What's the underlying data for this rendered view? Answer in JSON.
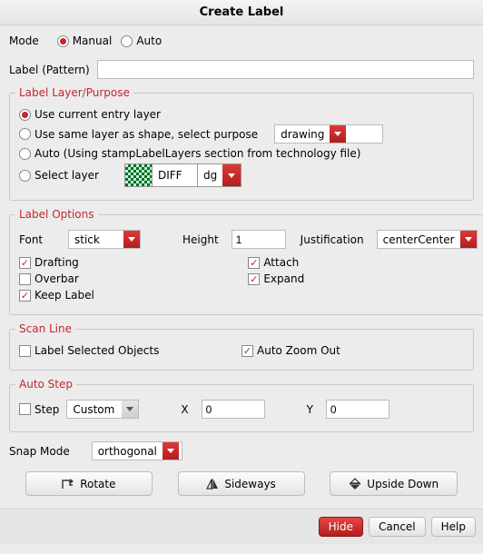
{
  "title": "Create Label",
  "mode": {
    "label": "Mode",
    "options": {
      "manual": "Manual",
      "auto": "Auto"
    },
    "selected": "manual"
  },
  "labelPattern": {
    "label": "Label (Pattern)",
    "value": ""
  },
  "layerPurpose": {
    "legend": "Label Layer/Purpose",
    "useCurrent": {
      "label": "Use current entry layer"
    },
    "sameShape": {
      "label": "Use same layer as shape, select purpose",
      "purpose": "drawing"
    },
    "autoTech": {
      "label": "Auto (Using stampLabelLayers section from technology file)"
    },
    "selectLayer": {
      "label": "Select layer",
      "layerName": "DIFF",
      "layerPurpose": "dg"
    },
    "selected": "useCurrent"
  },
  "labelOptions": {
    "legend": "Label Options",
    "fontLabel": "Font",
    "fontValue": "stick",
    "heightLabel": "Height",
    "heightValue": "1",
    "justificationLabel": "Justification",
    "justificationValue": "centerCenter",
    "drafting": {
      "label": "Drafting",
      "checked": true
    },
    "overbar": {
      "label": "Overbar",
      "checked": false
    },
    "keepLabel": {
      "label": "Keep Label",
      "checked": true
    },
    "attach": {
      "label": "Attach",
      "checked": true
    },
    "expand": {
      "label": "Expand",
      "checked": true
    }
  },
  "scanLine": {
    "legend": "Scan Line",
    "labelSelected": {
      "label": "Label Selected Objects",
      "checked": false
    },
    "autoZoomOut": {
      "label": "Auto Zoom Out",
      "checked": true
    }
  },
  "autoStep": {
    "legend": "Auto Step",
    "step": {
      "label": "Step",
      "checked": false,
      "value": "Custom"
    },
    "xLabel": "X",
    "xValue": "0",
    "yLabel": "Y",
    "yValue": "0"
  },
  "snapMode": {
    "label": "Snap Mode",
    "value": "orthogonal"
  },
  "actions": {
    "rotate": "Rotate",
    "sideways": "Sideways",
    "upsideDown": "Upside Down"
  },
  "footer": {
    "hide": "Hide",
    "cancel": "Cancel",
    "help": "Help"
  }
}
